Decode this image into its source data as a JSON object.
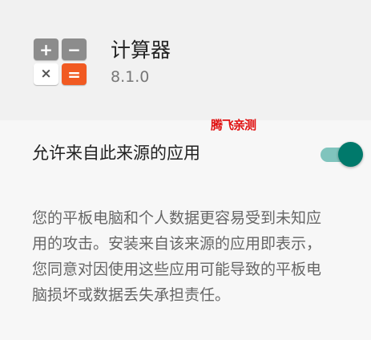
{
  "app": {
    "name": "计算器",
    "version": "8.1.0",
    "icon_keys": [
      "+",
      "−",
      "×",
      "="
    ]
  },
  "watermark": "腾飞亲测",
  "setting": {
    "label": "允许来自此来源的应用",
    "enabled": true
  },
  "description": {
    "lines": [
      "您的平板电脑和个人数据更容易受到未知应",
      "用的攻击。安装来自该来源的应用即表示，",
      "您同意对因使用这些应用可能导致的平板电",
      "脑损坏或数据丢失承担责任。"
    ]
  },
  "colors": {
    "accent": "#00796b",
    "accent_track": "#80c4bd",
    "header_bg": "#f1f1f1",
    "page_bg": "#f7f7f7",
    "calc_orange": "#f15a22",
    "calc_gray": "#8c8c8c",
    "watermark": "#e01010"
  }
}
